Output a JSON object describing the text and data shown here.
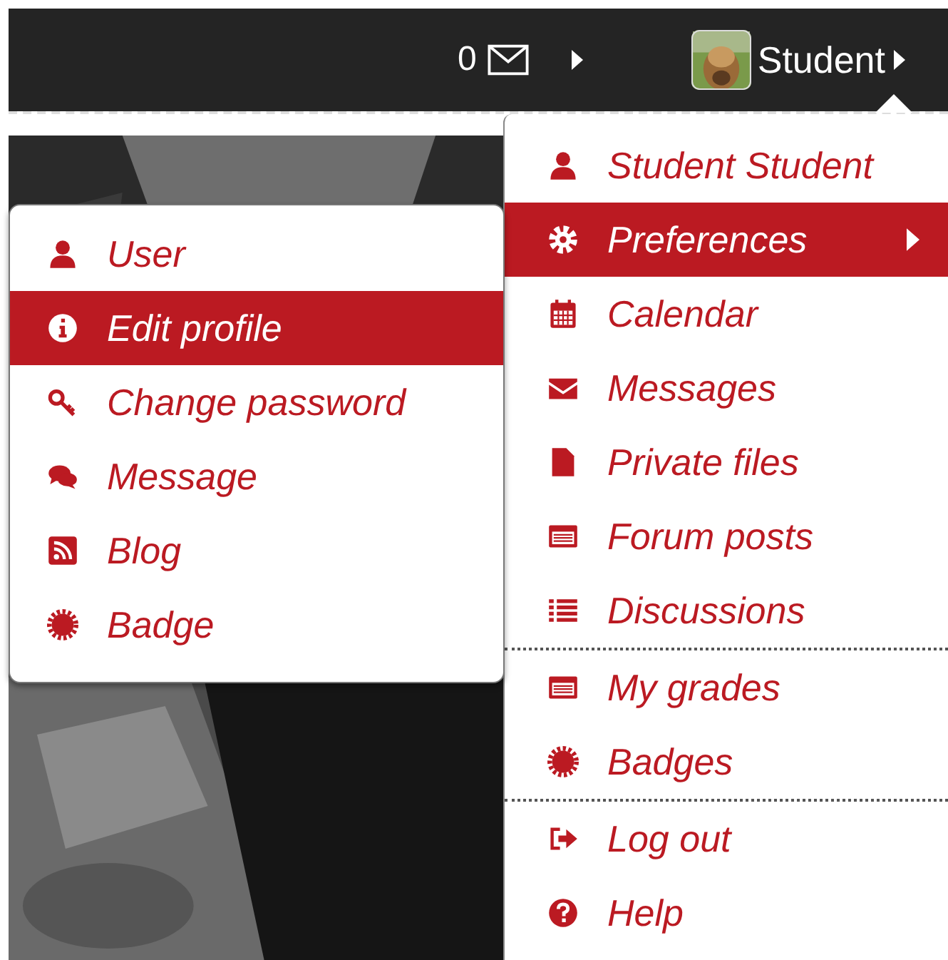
{
  "navbar": {
    "message_count": "0",
    "user_name": "Student"
  },
  "user_menu": {
    "sections": [
      [
        {
          "label": "Student Student",
          "selected": false,
          "submenu": false
        },
        {
          "label": "Preferences",
          "selected": true,
          "submenu": true
        },
        {
          "label": "Calendar",
          "selected": false,
          "submenu": false
        },
        {
          "label": "Messages",
          "selected": false,
          "submenu": false
        },
        {
          "label": "Private files",
          "selected": false,
          "submenu": false
        },
        {
          "label": "Forum posts",
          "selected": false,
          "submenu": false
        },
        {
          "label": "Discussions",
          "selected": false,
          "submenu": false
        }
      ],
      [
        {
          "label": "My grades",
          "selected": false,
          "submenu": false
        },
        {
          "label": "Badges",
          "selected": false,
          "submenu": false
        }
      ],
      [
        {
          "label": "Log out",
          "selected": false,
          "submenu": false
        },
        {
          "label": "Help",
          "selected": false,
          "submenu": false
        }
      ]
    ]
  },
  "preferences_menu": {
    "items": [
      {
        "label": "User",
        "selected": false
      },
      {
        "label": "Edit profile",
        "selected": true
      },
      {
        "label": "Change password",
        "selected": false
      },
      {
        "label": "Message",
        "selected": false
      },
      {
        "label": "Blog",
        "selected": false
      },
      {
        "label": "Badge",
        "selected": false
      }
    ]
  }
}
